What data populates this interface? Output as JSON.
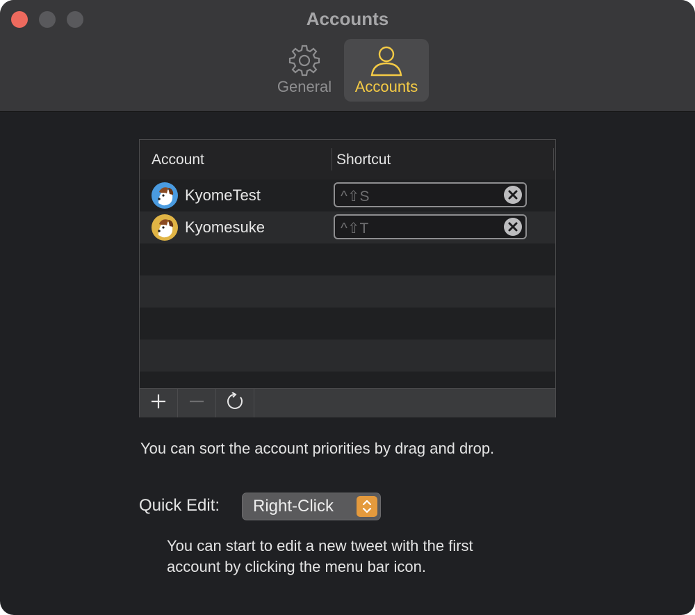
{
  "window": {
    "title": "Accounts",
    "tabs": [
      {
        "label": "General",
        "icon": "gear-icon",
        "selected": false
      },
      {
        "label": "Accounts",
        "icon": "person-icon",
        "selected": true
      }
    ],
    "accent_color": "#f5cb45"
  },
  "table": {
    "columns": [
      "Account",
      "Shortcut"
    ],
    "rows": [
      {
        "name": "KyomeTest",
        "shortcut": "^⇧S",
        "avatar_color": "#4a9be0"
      },
      {
        "name": "Kyomesuke",
        "shortcut": "^⇧T",
        "avatar_color": "#e0b445"
      }
    ],
    "footer_buttons": [
      "add",
      "remove",
      "refresh"
    ]
  },
  "hint_sort": "You can sort the account priorities by drag and drop.",
  "quick_edit": {
    "label": "Quick Edit:",
    "value": "Right-Click"
  },
  "hint_quick_edit_line1": "You can start to edit a new tweet with the first",
  "hint_quick_edit_line2": "account by clicking the menu bar icon."
}
